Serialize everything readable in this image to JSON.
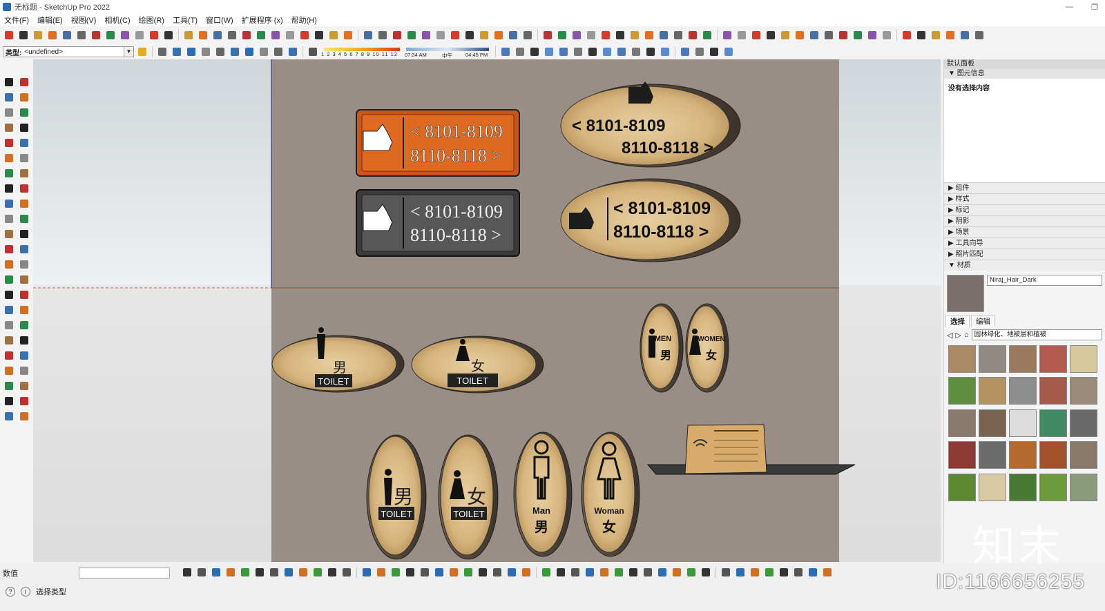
{
  "window": {
    "title": "无标题 - SketchUp Pro 2022",
    "minimize_glyph": "—",
    "restore_glyph": "❐"
  },
  "menu": [
    "文件(F)",
    "编辑(E)",
    "视图(V)",
    "相机(C)",
    "绘图(R)",
    "工具(T)",
    "窗口(W)",
    "扩展程序 (x)",
    "帮助(H)"
  ],
  "toolbar2": {
    "type_label": "类型:",
    "type_value": "<undefined>"
  },
  "shadows": {
    "months": "1 2 3 4 5 6 7 8 9 10 11 12",
    "time_start": "07:34 AM",
    "noon": "中午",
    "time_end": "04:45 PM"
  },
  "signs": {
    "room_line1_arrow": "< 8101-8109",
    "room_line2_arrow": "8110-8118 >"
  },
  "toilet": {
    "label": "TOILET",
    "male_cn": "男",
    "female_cn": "女",
    "men_en": "MEN",
    "women_en": "WOMEN",
    "man_en": "Man",
    "woman_en": "Woman"
  },
  "panel": {
    "title": "默认面板",
    "entity_info": "图元信息",
    "no_selection": "没有选择内容",
    "trays": [
      "组件",
      "样式",
      "标记",
      "阴影",
      "场景",
      "工具向导",
      "照片匹配"
    ],
    "materials": "材质",
    "material_name": "Niraj_Hair_Dark",
    "tab_select": "选择",
    "tab_edit": "编辑",
    "library": "园林绿化、地被层和植被",
    "swatch_colors": [
      "#a88a63",
      "#8f8a86",
      "#9a7a5e",
      "#b35a4e",
      "#d8c89b",
      "#5f8e3f",
      "#b39160",
      "#8e8e8e",
      "#a45a4a",
      "#9b8c7a",
      "#8a7a6e",
      "#7a6250",
      "#dcdcdc",
      "#3f8a62",
      "#6a6a6a",
      "#8e3a34",
      "#6b6b6b",
      "#b46a2e",
      "#a2512a",
      "#8a7868",
      "#5d8a30",
      "#d8c9a3",
      "#497a33",
      "#6a9a3a",
      "#8b9a7b"
    ]
  },
  "status": {
    "value_label": "数值",
    "text": "选择类型"
  },
  "watermark": {
    "brand": "知末",
    "id": "ID:1166656255"
  }
}
